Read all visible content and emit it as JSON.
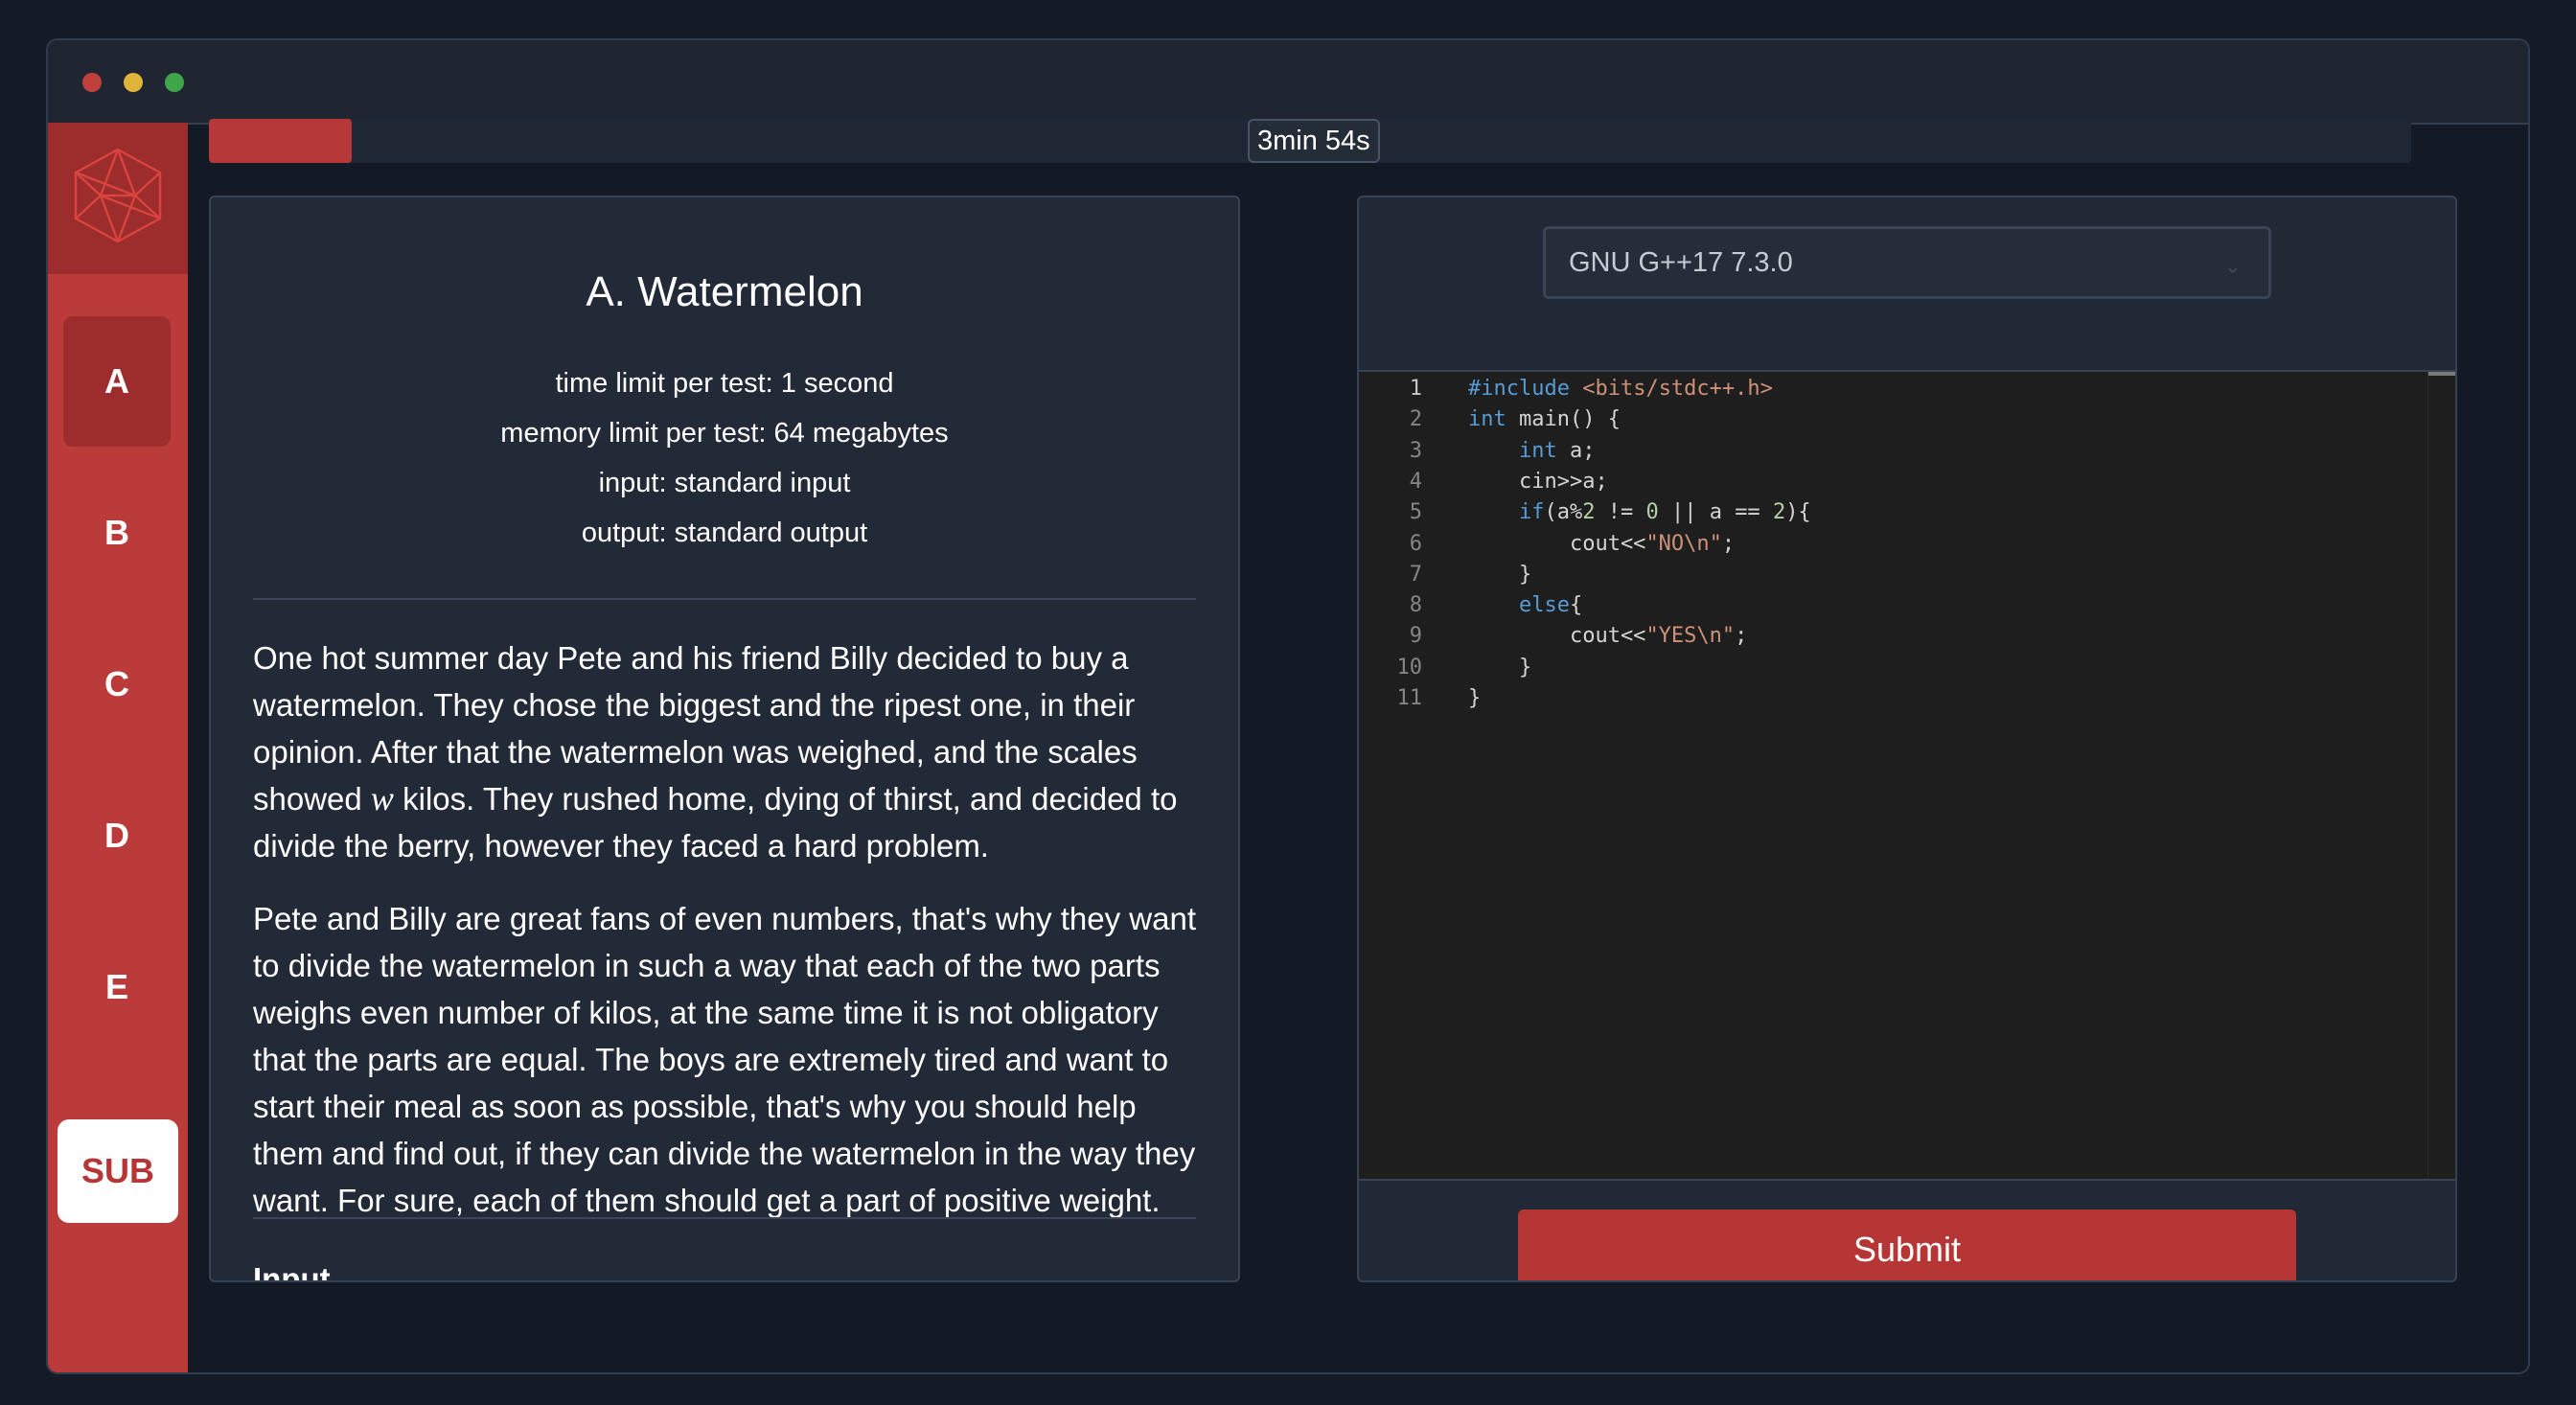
{
  "window": {
    "controls": [
      "close",
      "minimize",
      "maximize"
    ]
  },
  "sidebar": {
    "logo": "polyhedron-icon",
    "items": [
      {
        "label": "A",
        "active": true
      },
      {
        "label": "B",
        "active": false
      },
      {
        "label": "C",
        "active": false
      },
      {
        "label": "D",
        "active": false
      },
      {
        "label": "E",
        "active": false
      }
    ],
    "submissions_label": "SUB"
  },
  "timer": {
    "label": "3min 54s",
    "progress_percent": 6.5
  },
  "problem": {
    "title": "A. Watermelon",
    "time_limit": "time limit per test: 1 second",
    "memory_limit": "memory limit per test: 64 megabytes",
    "input": "input: standard input",
    "output": "output: standard output",
    "para1_a": "One hot summer day Pete and his friend Billy decided to buy a watermelon. They chose the biggest and the ripest one, in their opinion. After that the watermelon was weighed, and the scales showed ",
    "para1_var": "w",
    "para1_b": " kilos. They rushed home, dying of thirst, and decided to divide the berry, however they faced a hard problem.",
    "para2": "Pete and Billy are great fans of even numbers, that's why they want to divide the watermelon in such a way that each of the two parts weighs even number of kilos, at the same time it is not obligatory that the parts are equal. The boys are extremely tired and want to start their meal as soon as possible, that's why you should help them and find out, if they can divide the watermelon in the way they want. For sure, each of them should get a part of positive weight.",
    "input_heading": "Input"
  },
  "editor": {
    "language": "GNU G++17 7.3.0",
    "lines": [
      {
        "n": "1",
        "code": "#include <bits/stdc++.h>"
      },
      {
        "n": "2",
        "code": "int main() {"
      },
      {
        "n": "3",
        "code": "    int a;"
      },
      {
        "n": "4",
        "code": "    cin>>a;"
      },
      {
        "n": "5",
        "code": "    if(a%2 != 0 || a == 2){"
      },
      {
        "n": "6",
        "code": "        cout<<\"NO\\n\";"
      },
      {
        "n": "7",
        "code": "    }"
      },
      {
        "n": "8",
        "code": "    else{"
      },
      {
        "n": "9",
        "code": "        cout<<\"YES\\n\";"
      },
      {
        "n": "10",
        "code": "    }"
      },
      {
        "n": "11",
        "code": "}"
      }
    ],
    "submit_label": "Submit"
  },
  "colors": {
    "accent": "#b63636",
    "accent_dark": "#9c2d2c",
    "background": "#141b27",
    "panel": "#232a37"
  }
}
